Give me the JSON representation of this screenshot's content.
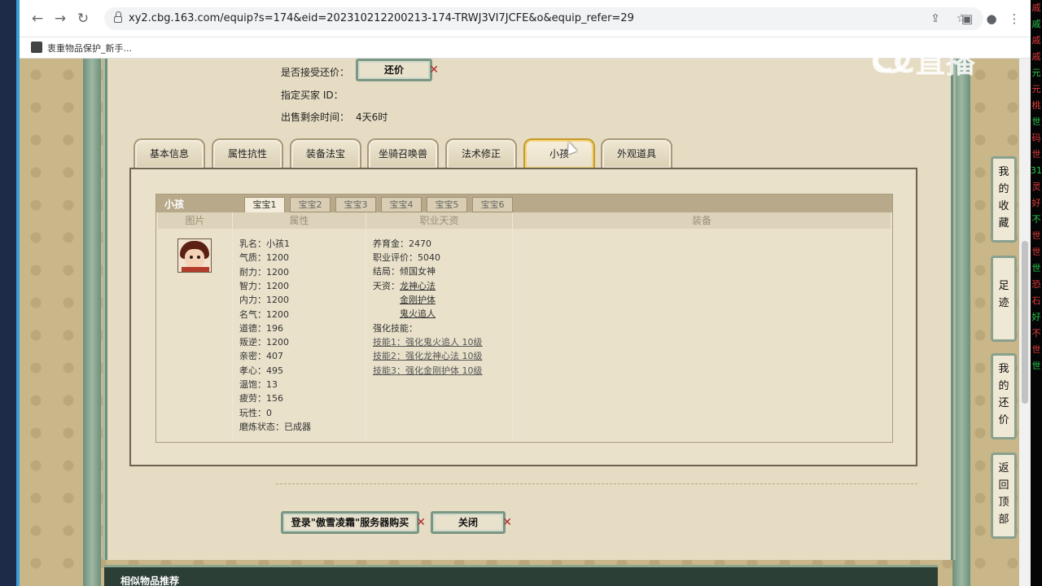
{
  "browser": {
    "url": "xy2.cbg.163.com/equip?s=174&eid=202310212200213-174-TRWJ3VI7JCFE&o&equip_refer=29",
    "bookmark": "衷重物品保护_新手..."
  },
  "ticker": [
    "戚",
    "戚",
    "戚",
    "戚",
    "元",
    "元",
    "桃",
    "世",
    "码",
    "世",
    "31",
    "灵",
    "好",
    "不",
    "世",
    "世",
    "世",
    "恐",
    "石",
    "好",
    "不",
    "世",
    "世"
  ],
  "sale": {
    "bargain_label": "是否接受还价：",
    "bargain_button": "还价",
    "buyer_label": "指定买家 ID：",
    "remaining_label": "出售剩余时间：",
    "remaining_value": "4天6时"
  },
  "tabs": [
    "基本信息",
    "属性抗性",
    "装备法宝",
    "坐骑召唤兽",
    "法术修正",
    "小孩",
    "外观道具"
  ],
  "child": {
    "title": "小孩",
    "subtabs": [
      "宝宝1",
      "宝宝2",
      "宝宝3",
      "宝宝4",
      "宝宝5",
      "宝宝6"
    ],
    "columns": [
      "图片",
      "属性",
      "职业天资",
      "装备"
    ],
    "attrs": [
      {
        "k": "乳名：",
        "v": "小孩1"
      },
      {
        "k": "气质：",
        "v": "1200"
      },
      {
        "k": "耐力：",
        "v": "1200"
      },
      {
        "k": "智力：",
        "v": "1200"
      },
      {
        "k": "内力：",
        "v": "1200"
      },
      {
        "k": "名气：",
        "v": "1200"
      },
      {
        "k": "道德：",
        "v": "196"
      },
      {
        "k": "叛逆：",
        "v": "1200"
      },
      {
        "k": "亲密：",
        "v": "407"
      },
      {
        "k": "孝心：",
        "v": "495"
      },
      {
        "k": "温饱：",
        "v": "13"
      },
      {
        "k": "疲劳：",
        "v": "156"
      },
      {
        "k": "玩性：",
        "v": "0"
      },
      {
        "k": "磨炼状态：",
        "v": "已成器"
      }
    ],
    "career": {
      "fee_k": "养育金：",
      "fee_v": "2470",
      "rating_k": "职业评价：",
      "rating_v": "5040",
      "ending_k": "结局：",
      "ending_v": "倾国女神",
      "talent_k": "天资：",
      "talents": [
        "龙神心法",
        "金刚护体",
        "鬼火追人"
      ],
      "skills_k": "强化技能：",
      "skills": [
        "技能1：强化鬼火追人 10级",
        "技能2：强化龙神心法 10级",
        "技能3：强化金刚护体 10级"
      ]
    }
  },
  "actions": {
    "login_buy": "登录\"傲雪凌霜\"服务器购买",
    "close": "关闭"
  },
  "similar_title": "相似物品推荐",
  "float_buttons": [
    {
      "name": "我的收藏",
      "chars": [
        "我",
        "的",
        "收",
        "藏"
      ]
    },
    {
      "name": "足迹",
      "chars": [
        "足",
        "迹"
      ]
    },
    {
      "name": "我的还价",
      "chars": [
        "我",
        "的",
        "还",
        "价"
      ]
    },
    {
      "name": "返回顶部",
      "chars": [
        "返",
        "回",
        "顶",
        "部"
      ]
    }
  ],
  "watermark": "CC直播"
}
